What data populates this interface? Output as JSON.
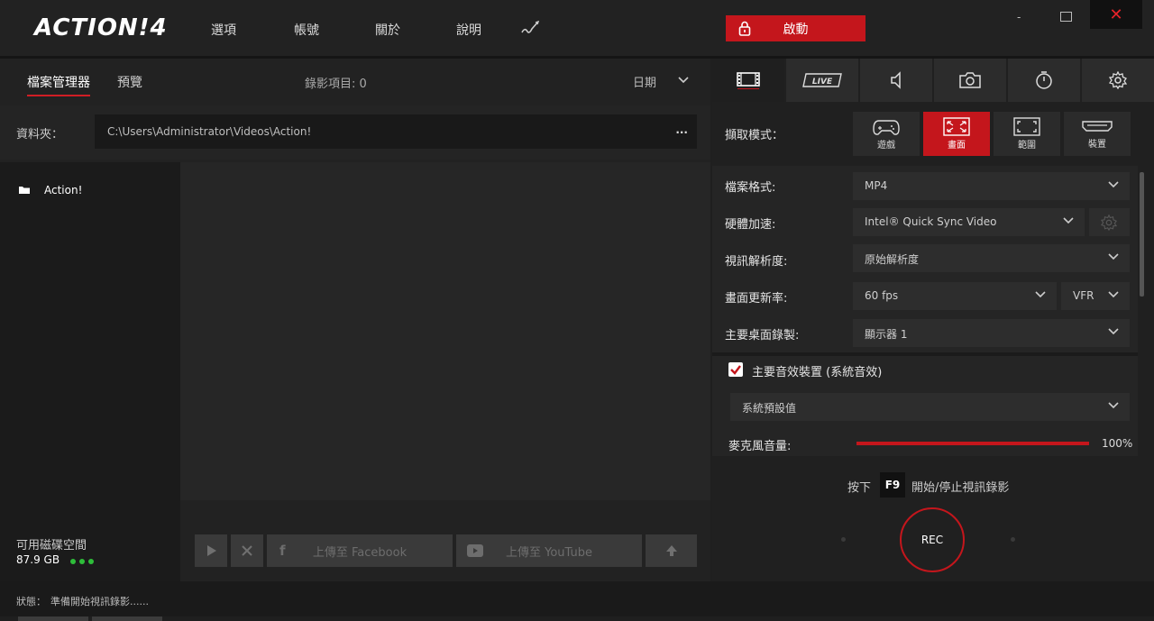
{
  "app": {
    "logo": "ACTION!4"
  },
  "menu": {
    "options": "選項",
    "account": "帳號",
    "about": "關於",
    "help": "說明"
  },
  "start_button": {
    "label": "啟動"
  },
  "window": {
    "minimize": "-",
    "close": "✕"
  },
  "left": {
    "tabs": [
      {
        "label": "檔案管理器"
      },
      {
        "label": "預覽"
      }
    ],
    "recording_count": "錄影項目: 0",
    "sort": {
      "label": "日期"
    },
    "folder_label": "資料夾：",
    "folder_path": "C:\\Users\\Administrator\\Videos\\Action!",
    "folder_more": "...",
    "tree_items": [
      {
        "label": "Action!"
      }
    ],
    "disk_label": "可用磁碟空間",
    "disk_value": "87.9 GB",
    "upload_facebook": "上傳至 Facebook",
    "upload_youtube": "上傳至 YouTube"
  },
  "status": {
    "label": "狀態：",
    "text": "準備開始視訊錄影......"
  },
  "right": {
    "tabs": [
      "video",
      "live",
      "audio",
      "screenshot",
      "timer",
      "settings"
    ],
    "live_text": "LIVE",
    "capture_mode_label": "擷取模式：",
    "modes": [
      {
        "label": "遊戲"
      },
      {
        "label": "畫面"
      },
      {
        "label": "範圍"
      },
      {
        "label": "裝置"
      }
    ],
    "active_mode": "畫面",
    "file_format": {
      "label": "檔案格式:",
      "value": "MP4"
    },
    "hw_accel": {
      "label": "硬體加速:",
      "value": "Intel® Quick Sync Video"
    },
    "resolution": {
      "label": "視訊解析度:",
      "value": "原始解析度"
    },
    "framerate": {
      "label": "畫面更新率:",
      "value": "60 fps",
      "mode": "VFR"
    },
    "main_desktop": {
      "label": "主要桌面錄製:",
      "value": "顯示器 1"
    },
    "audio_device": {
      "label": "主要音效裝置 (系統音效)",
      "checked": true
    },
    "audio_default": "系統預設值",
    "mic_volume": {
      "label": "麥克風音量:",
      "value": "100%",
      "level": 1.0
    },
    "hotkey_prefix": "按下",
    "hotkey_key": "F9",
    "hotkey_suffix": "開始/停止視訊錄影",
    "rec_label": "REC"
  },
  "colors": {
    "accent": "#c4161c",
    "bg": "#1f1f1f"
  }
}
